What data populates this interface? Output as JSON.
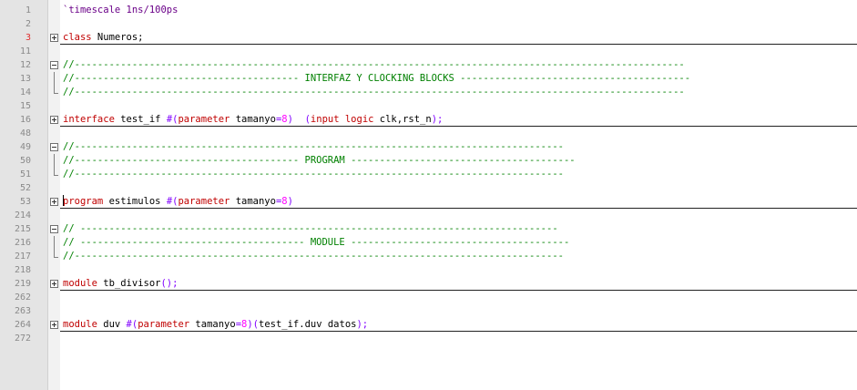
{
  "editor": {
    "lines": [
      {
        "num": "1",
        "text": "`timescale 1ns/100ps"
      },
      {
        "num": "2",
        "text": ""
      },
      {
        "num": "3",
        "kw": "class",
        "rest": " Numeros;"
      },
      {
        "num": "11",
        "text": ""
      },
      {
        "num": "12",
        "text": "//----------------------------------------------------------------------------------------------------------"
      },
      {
        "num": "13",
        "text": "//--------------------------------------- INTERFAZ Y CLOCKING BLOCKS ----------------------------------------"
      },
      {
        "num": "14",
        "text": "//----------------------------------------------------------------------------------------------------------"
      },
      {
        "num": "15",
        "text": ""
      },
      {
        "num": "16",
        "kw": "interface",
        "p1": " test_if ",
        "op1": "#(",
        "kw2": "parameter",
        "p2": " tamanyo",
        "op2": "=",
        "n": "8",
        "op3": ")",
        "p3": "  ",
        "op4": "(",
        "kw3": "input",
        "p4": " ",
        "kw4": "logic",
        "p5": " clk,rst_n",
        "op5": ");"
      },
      {
        "num": "48",
        "text": ""
      },
      {
        "num": "49",
        "text": "//-------------------------------------------------------------------------------------"
      },
      {
        "num": "50",
        "text": "//--------------------------------------- PROGRAM ---------------------------------------"
      },
      {
        "num": "51",
        "text": "//-------------------------------------------------------------------------------------"
      },
      {
        "num": "52",
        "text": ""
      },
      {
        "num": "53",
        "kw": "program",
        "p1": " estimulos ",
        "op1": "#(",
        "kw2": "parameter",
        "p2": " tamanyo",
        "op2": "=",
        "n": "8",
        "op3": ")"
      },
      {
        "num": "214",
        "text": ""
      },
      {
        "num": "215",
        "text": "// -----------------------------------------------------------------------------------"
      },
      {
        "num": "216",
        "text": "// --------------------------------------- MODULE --------------------------------------"
      },
      {
        "num": "217",
        "text": "//-------------------------------------------------------------------------------------"
      },
      {
        "num": "218",
        "text": ""
      },
      {
        "num": "219",
        "kw": "module",
        "p1": " tb_divisor",
        "op1": "();"
      },
      {
        "num": "262",
        "text": ""
      },
      {
        "num": "263",
        "text": ""
      },
      {
        "num": "264",
        "kw": "module",
        "p1": " duv ",
        "op1": "#(",
        "kw2": "parameter",
        "p2": " tamanyo",
        "op2": "=",
        "n": "8",
        "op3": ")(",
        "p3": "test_if.duv datos",
        "op4": ");"
      },
      {
        "num": "272",
        "text": ""
      }
    ]
  },
  "icons": {
    "fold_collapsed": "plus-box-icon",
    "fold_expanded": "minus-box-icon"
  },
  "colors": {
    "keyword": "#c00000",
    "operator": "#8000ff",
    "number": "#ff00ff",
    "comment": "#008000",
    "directive": "#6a0088"
  }
}
